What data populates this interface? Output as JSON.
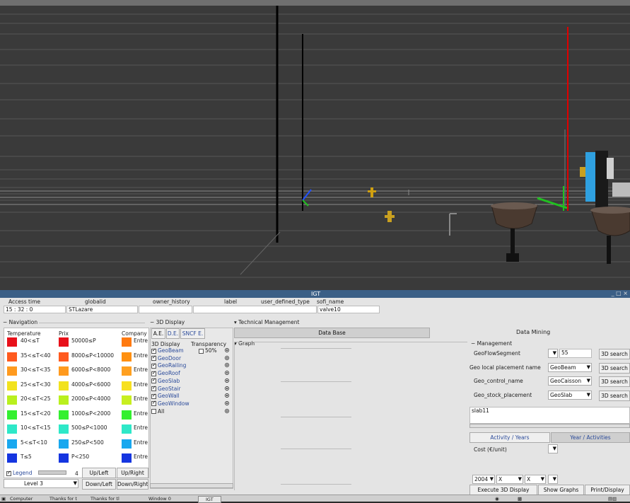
{
  "window": {
    "title": "IGT",
    "controls": "_ □ ×"
  },
  "info_bar": {
    "headers": [
      "Access time",
      "globalid",
      "owner_history",
      "label",
      "user_defined_type",
      "sofi_name"
    ],
    "values": [
      "15 : 32 : 0",
      "STLazare",
      "",
      "",
      "",
      "valve10"
    ]
  },
  "navigation": {
    "title": "Navigation",
    "columns": [
      "Temperature",
      "Prix",
      "Company"
    ],
    "temperature_rows": [
      "40<≤T",
      "35<≤T<40",
      "30<≤T<35",
      "25<≤T<30",
      "20<≤T<25",
      "15<≤T<20",
      "10<≤T<15",
      "5<≤T<10",
      "T≤5"
    ],
    "price_rows": [
      "50000≤P",
      "8000≤P<10000",
      "6000≤P<8000",
      "4000≤P<6000",
      "2000≤P<4000",
      "1000≤P<2000",
      "500≤P<1000",
      "250≤P<500",
      "P<250"
    ],
    "company_rows": [
      "Entre",
      "Entre",
      "Entre",
      "Entre",
      "Entre",
      "Entre",
      "Entre",
      "Entre",
      "Entre"
    ],
    "temp_colors": [
      "#e8101a",
      "#ff5a1e",
      "#ff9a1e",
      "#f2e21e",
      "#b9f01e",
      "#34f030",
      "#2ee8c8",
      "#19a8ef",
      "#1535e0"
    ],
    "price_colors": [
      "#e8101a",
      "#ff5a1e",
      "#ff9a1e",
      "#f2e21e",
      "#b9f01e",
      "#34f030",
      "#2ee8c8",
      "#19a8ef",
      "#1535e0"
    ],
    "company_colors": [
      "#ff7a10",
      "#ff9010",
      "#ffa020",
      "#f7e020",
      "#c8ef20",
      "#34f030",
      "#2ee8c8",
      "#19a8ef",
      "#1535e0"
    ],
    "legend_label": "Legend",
    "legend_value": "4",
    "level_label": "Level 3",
    "buttons": [
      "Up/Left",
      "Up/Right",
      "Down/Left",
      "Down/Right"
    ]
  },
  "display3d": {
    "title": "3D Display",
    "tabs": [
      "A.E.",
      "D.E.",
      "SNCF E."
    ],
    "col_headers": [
      "3D Display",
      "Transparency"
    ],
    "transparency_value": "50%",
    "items": [
      "GeoBeam",
      "GeoDoor",
      "GeoRailing",
      "GeoRoof",
      "GeoSlab",
      "GeoStair",
      "GeoWall",
      "GeoWindow",
      "All"
    ]
  },
  "technical": {
    "title": "Technical Management",
    "db_button": "Data Base",
    "graph_label": "Graph"
  },
  "datamining": {
    "title": "Data Mining",
    "management_label": "Management",
    "rows": [
      {
        "label": "GeoFlowSegment",
        "value": "",
        "field": "55",
        "search": "3D search"
      },
      {
        "label": "Geo local placement name",
        "value": "GeoBeam",
        "field": "",
        "search": "3D search"
      },
      {
        "label": "Geo_control_name",
        "value": "GeoCaisson",
        "field": "",
        "search": "3D search"
      },
      {
        "label": "Geo_stock_placement",
        "value": "GeoSlab",
        "field": "",
        "search": "3D search"
      }
    ],
    "slab_value": "slab11",
    "tabs": [
      "Activity / Years",
      "Year / Activities"
    ],
    "cost_label": "Cost (€/unit)",
    "year_value": "2004",
    "x1": "X",
    "x2": "X",
    "buttons": [
      "Execute 3D Display",
      "Show Graphs",
      "Print/Display"
    ]
  },
  "taskbar": {
    "items": [
      "Computer",
      "Thanks for t",
      "Thanks for tl",
      "Window 0",
      "IGT"
    ]
  }
}
